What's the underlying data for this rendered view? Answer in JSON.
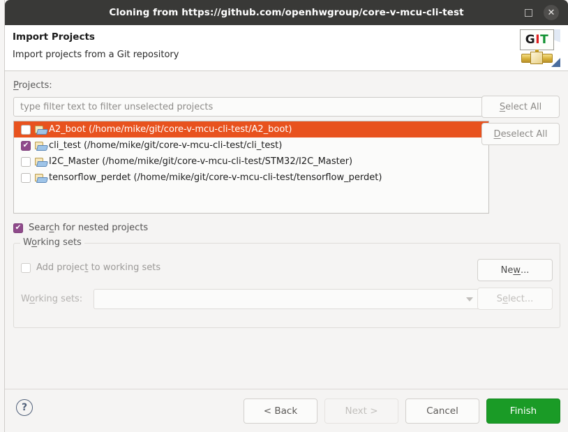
{
  "window": {
    "title": "Cloning from https://github.com/openhwgroup/core-v-mcu-cli-test",
    "maximize_label": "",
    "close_label": "✕"
  },
  "header": {
    "title": "Import Projects",
    "description": "Import projects from a Git repository",
    "logo": {
      "g": "G",
      "i": "I",
      "t": "T"
    }
  },
  "projects_section": {
    "label": "Projects:",
    "filter_placeholder": "type filter text to filter unselected projects",
    "select_all_label": "Select All",
    "deselect_all_label": "Deselect All",
    "items": [
      {
        "name": "A2_boot (/home/mike/git/core-v-mcu-cli-test/A2_boot)",
        "checked": false,
        "selected": true
      },
      {
        "name": "cli_test (/home/mike/git/core-v-mcu-cli-test/cli_test)",
        "checked": true,
        "selected": false
      },
      {
        "name": "I2C_Master (/home/mike/git/core-v-mcu-cli-test/STM32/I2C_Master)",
        "checked": false,
        "selected": false
      },
      {
        "name": "tensorflow_perdet (/home/mike/git/core-v-mcu-cli-test/tensorflow_perdet)",
        "checked": false,
        "selected": false
      }
    ]
  },
  "nested": {
    "label": "Search for nested projects",
    "checked": true,
    "checkmark": "✔"
  },
  "working_sets": {
    "legend": "Working sets",
    "add_label": "Add project to working sets",
    "add_checked": false,
    "select_label": "Working sets:",
    "combo_value": "",
    "new_button": "New...",
    "select_button": "Select..."
  },
  "footer": {
    "help_glyph": "?",
    "back_label": "< Back",
    "next_label": "Next >",
    "cancel_label": "Cancel",
    "finish_label": "Finish"
  },
  "colors": {
    "selection_orange": "#e8521e",
    "checkbox_purple": "#8f4a8b",
    "finish_green": "#1a9b26",
    "titlebar": "#393937"
  }
}
